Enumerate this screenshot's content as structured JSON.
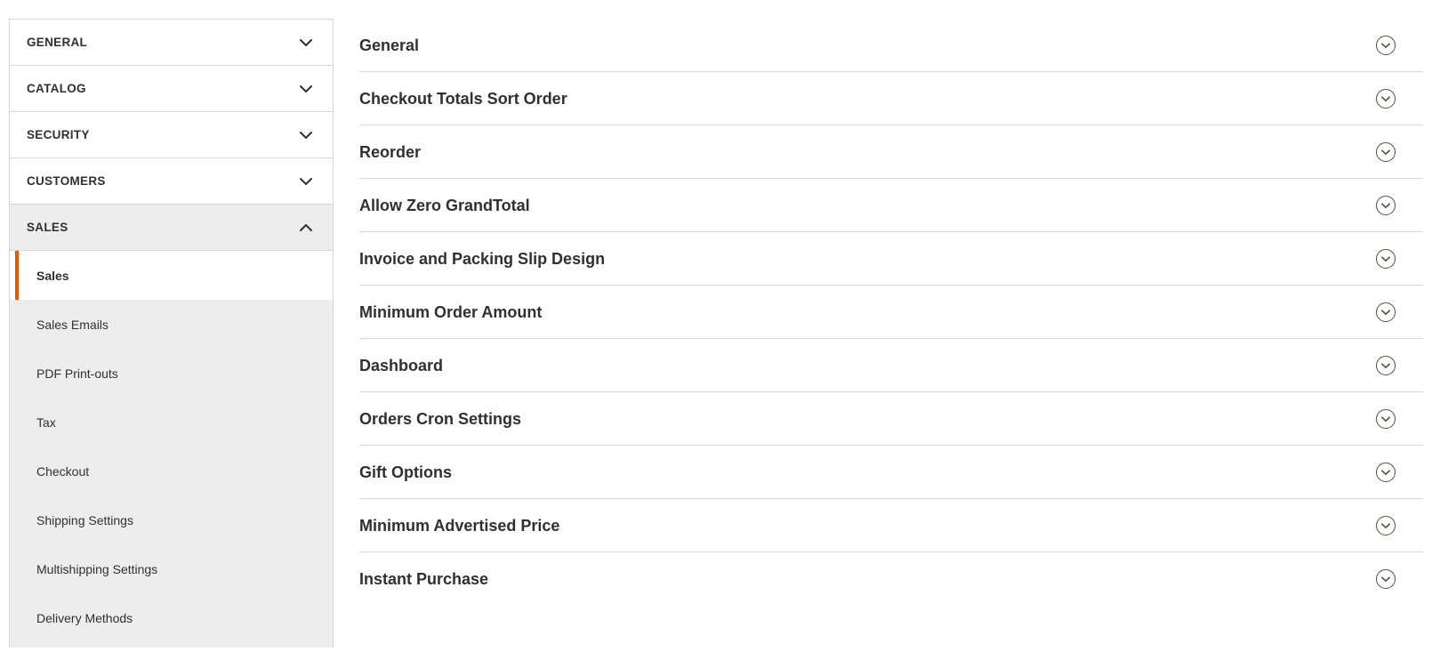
{
  "sidebar": {
    "sections": [
      {
        "label": "GENERAL",
        "state": "collapsed",
        "icon": "chevron-down-icon"
      },
      {
        "label": "CATALOG",
        "state": "collapsed",
        "icon": "chevron-down-icon"
      },
      {
        "label": "SECURITY",
        "state": "collapsed",
        "icon": "chevron-down-icon"
      },
      {
        "label": "CUSTOMERS",
        "state": "collapsed",
        "icon": "chevron-down-icon"
      },
      {
        "label": "SALES",
        "state": "expanded",
        "icon": "chevron-up-icon"
      }
    ],
    "sales_items": [
      {
        "label": "Sales",
        "current": true
      },
      {
        "label": "Sales Emails",
        "current": false
      },
      {
        "label": "PDF Print-outs",
        "current": false
      },
      {
        "label": "Tax",
        "current": false
      },
      {
        "label": "Checkout",
        "current": false
      },
      {
        "label": "Shipping Settings",
        "current": false
      },
      {
        "label": "Multishipping Settings",
        "current": false
      },
      {
        "label": "Delivery Methods",
        "current": false
      }
    ],
    "active_section_index": 4
  },
  "main": {
    "fieldsets": [
      {
        "label": "General",
        "icon": "chevron-down-circle-icon"
      },
      {
        "label": "Checkout Totals Sort Order",
        "icon": "chevron-down-circle-icon"
      },
      {
        "label": "Reorder",
        "icon": "chevron-down-circle-icon"
      },
      {
        "label": "Allow Zero GrandTotal",
        "icon": "chevron-down-circle-icon"
      },
      {
        "label": "Invoice and Packing Slip Design",
        "icon": "chevron-down-circle-icon"
      },
      {
        "label": "Minimum Order Amount",
        "icon": "chevron-down-circle-icon"
      },
      {
        "label": "Dashboard",
        "icon": "chevron-down-circle-icon"
      },
      {
        "label": "Orders Cron Settings",
        "icon": "chevron-down-circle-icon"
      },
      {
        "label": "Gift Options",
        "icon": "chevron-down-circle-icon"
      },
      {
        "label": "Minimum Advertised Price",
        "icon": "chevron-down-circle-icon"
      },
      {
        "label": "Instant Purchase",
        "icon": "chevron-down-circle-icon"
      }
    ]
  },
  "colors": {
    "accent": "#eb5202",
    "text": "#303030",
    "border": "#d6d6d6",
    "panel_active_bg": "#ededed",
    "icon_stroke": "#514943"
  }
}
